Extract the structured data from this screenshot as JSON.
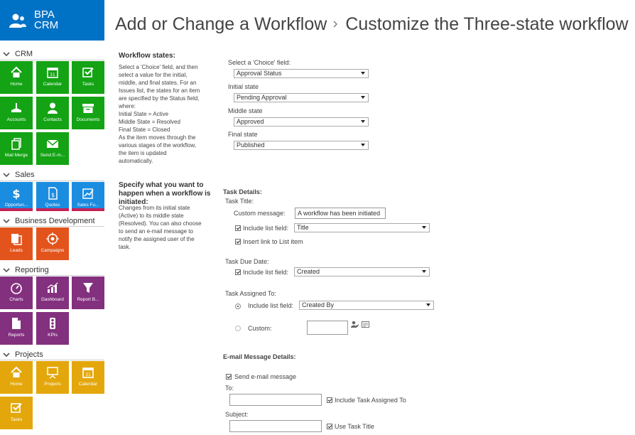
{
  "brand": {
    "line1": "BPA",
    "line2": "CRM"
  },
  "title": {
    "part1": "Add or Change a Workflow",
    "part2": "Customize the Three-state workflow"
  },
  "sidebar": {
    "sections": [
      {
        "label": "CRM",
        "tiles": [
          "Home",
          "Calendar",
          "Tasks",
          "Accounts",
          "Contacts",
          "Documents",
          "Mail Merge",
          "Send E-m..."
        ]
      },
      {
        "label": "Sales",
        "tiles": [
          "Opportun...",
          "Quotes",
          "Sales Fu..."
        ]
      },
      {
        "label": "Business Development",
        "tiles": [
          "Leads",
          "Campaigns"
        ]
      },
      {
        "label": "Reporting",
        "tiles": [
          "Charts",
          "Dashboard",
          "Report B...",
          "Reports",
          "KPIs"
        ]
      },
      {
        "label": "Projects",
        "tiles": [
          "Home",
          "Projects",
          "Calendar",
          "Tasks"
        ]
      }
    ]
  },
  "states": {
    "heading": "Workflow states:",
    "description": [
      "Select a 'Choice' field, and then",
      "select a value for the initial,",
      "middle, and final states. For an",
      "Issues list, the states for an item",
      "are specified by the Status field,",
      "where:",
      "Initial State = Active",
      "Middle State = Resolved",
      "Final State = Closed",
      "As the item moves through the",
      "various stages of the workflow,",
      "the item is updated",
      "automatically."
    ],
    "choice_label": "Select a 'Choice' field:",
    "choice_value": "Approval Status",
    "initial_label": "Initial state",
    "initial_value": "Pending Approval",
    "middle_label": "Middle state",
    "middle_value": "Approved",
    "final_label": "Final state",
    "final_value": "Published"
  },
  "initiated": {
    "heading": [
      "Specify what you want to",
      "happen when a workflow is",
      "initiated:"
    ],
    "description": [
      "Changes from its initial state",
      "(Active) to its middle state",
      "(Resolved). You can also choose",
      "to send an e-mail message to",
      "notify the assigned user of the",
      "task."
    ]
  },
  "task": {
    "heading": "Task Details:",
    "title_label": "Task Title:",
    "custom_message_label": "Custom message:",
    "custom_message_value": "A workflow has been initiated",
    "include_field_label": "Include list field:",
    "include_field_value": "Title",
    "insert_link_label": "Insert link to List item",
    "due_label": "Task Due Date:",
    "due_field_label": "Include list field:",
    "due_field_value": "Created",
    "assigned_label": "Task Assigned To:",
    "assigned_field_label": "Include list field:",
    "assigned_field_value": "Created By",
    "custom_label": "Custom:",
    "custom_value": ""
  },
  "email": {
    "heading": "E-mail Message Details:",
    "send_label": "Send e-mail message",
    "to_label": "To:",
    "to_value": "",
    "include_assigned_label": "Include Task Assigned To",
    "subject_label": "Subject:",
    "subject_value": "",
    "use_task_title_label": "Use Task Title"
  },
  "colors": {
    "brand": "#0072c6",
    "crm": "#14a314",
    "sales": "#1b8de0",
    "bizdev": "#e3541c",
    "reporting": "#83307f",
    "projects": "#e4a70b"
  }
}
